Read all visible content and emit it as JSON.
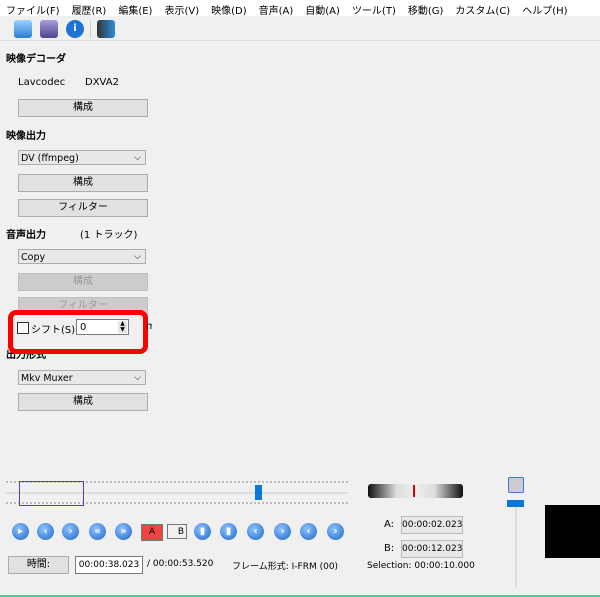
{
  "menu": [
    "ファイル(F)",
    "履歴(R)",
    "編集(E)",
    "表示(V)",
    "映像(D)",
    "音声(A)",
    "自動(A)",
    "ツール(T)",
    "移動(G)",
    "カスタム(C)",
    "ヘルプ(H)"
  ],
  "toolbar": {
    "icons": [
      "open-folder-icon",
      "save-disk-icon",
      "info-icon",
      "video-filter-icon"
    ]
  },
  "video_decoder": {
    "heading": "映像デコーダ",
    "decoder": "Lavcodec",
    "accel": "DXVA2",
    "configure": "構成"
  },
  "video_output": {
    "heading": "映像出力",
    "codec": "DV (ffmpeg)",
    "configure": "構成",
    "filters": "フィルター"
  },
  "audio_output": {
    "heading": "音声出力",
    "tracks": "(1 トラック)",
    "codec": "Copy",
    "configure": "構成",
    "filters": "フィルター",
    "shift_label": "シフト(S):",
    "shift_checked": false,
    "shift_value": "0",
    "shift_unit": "ms"
  },
  "output_format": {
    "heading": "出力形式",
    "container": "Mkv Muxer",
    "configure": "構成"
  },
  "timeline": {
    "position_fraction": 0.71,
    "selection_start_fraction": 0.038,
    "selection_end_fraction": 0.226
  },
  "nav_buttons": [
    "play",
    "prev-frame",
    "next-frame",
    "prev-keyframe",
    "next-keyframe",
    "set-marker-a",
    "set-marker-b",
    "go-start",
    "go-end",
    "prev-black",
    "next-black",
    "back-1min",
    "forward-1min"
  ],
  "markers": {
    "a_label": "A:",
    "a_value": "00:00:02.023",
    "b_label": "B:",
    "b_value": "00:00:12.023",
    "selection_label": "Selection:",
    "selection_value": "00:00:10.000",
    "marker_a_text": "A",
    "marker_b_text": "B"
  },
  "status": {
    "time_button": "時間:",
    "current_time": "00:00:38.023",
    "total_time": "/ 00:00:53.520",
    "frame_type": "フレーム形式: I-FRM (00)"
  },
  "highlight_color": "#ff0000"
}
